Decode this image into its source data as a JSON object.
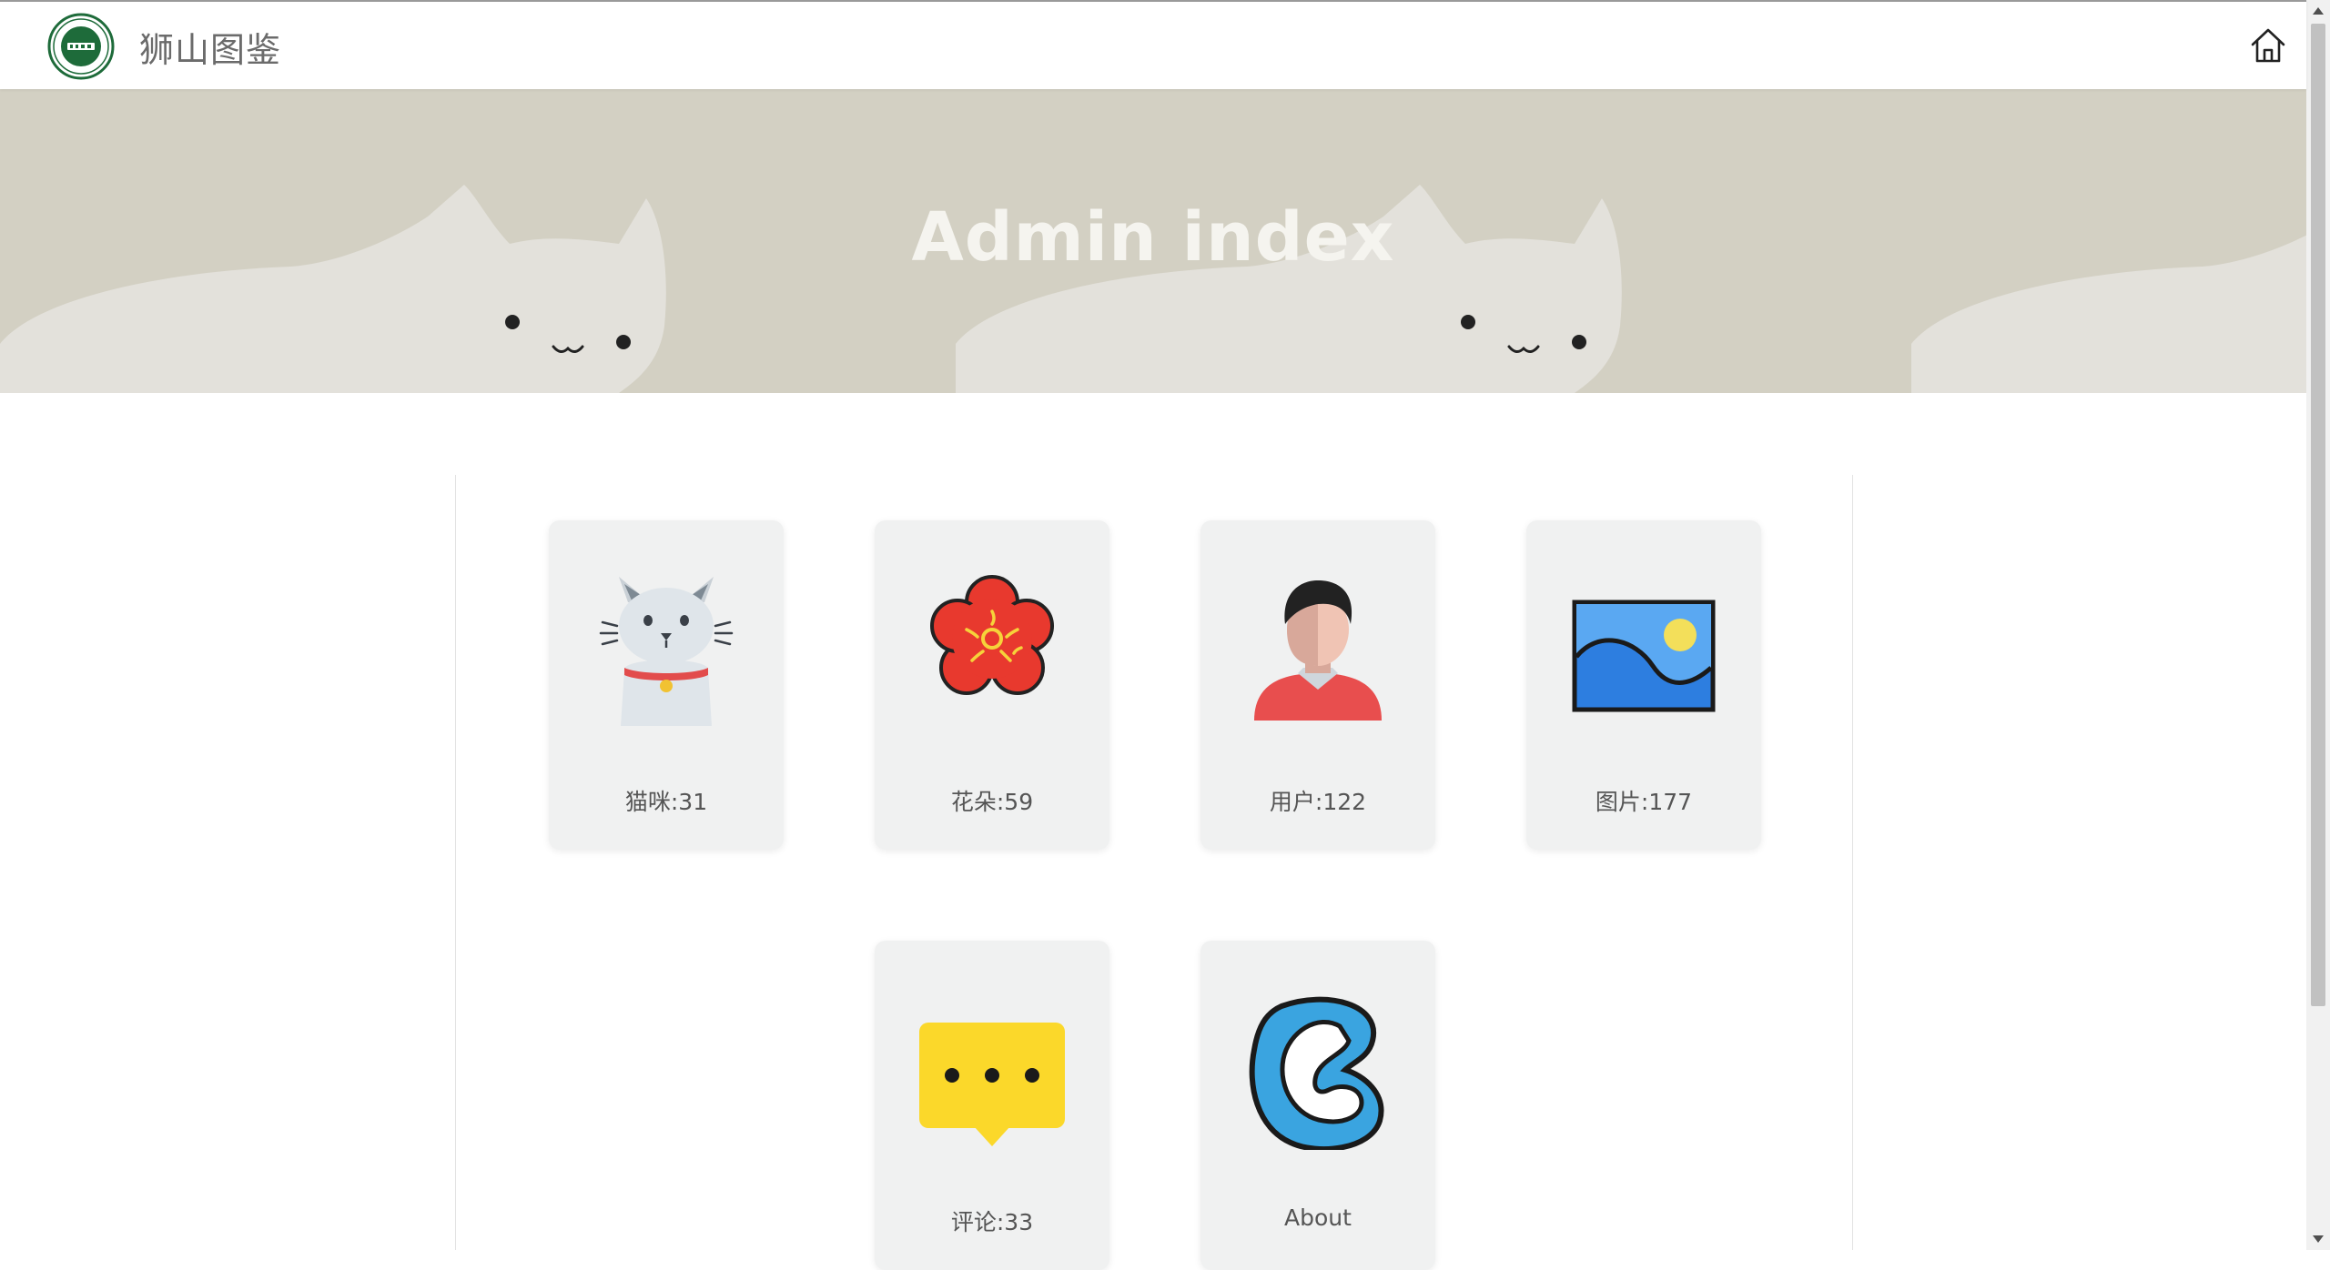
{
  "header": {
    "site_title": "狮山图鉴",
    "logo_icon": "campus-seal-logo",
    "home_icon": "home-icon"
  },
  "hero": {
    "title": "Admin index"
  },
  "cards": [
    {
      "label": "猫咪:31",
      "icon": "cat-icon"
    },
    {
      "label": "花朵:59",
      "icon": "flower-icon"
    },
    {
      "label": "用户:122",
      "icon": "user-icon"
    },
    {
      "label": "图片:177",
      "icon": "image-icon"
    },
    {
      "label": "评论:33",
      "icon": "comment-icon"
    },
    {
      "label": "About",
      "icon": "about-logo-icon"
    }
  ],
  "colors": {
    "hero_bg": "#d3d0c3",
    "card_bg": "#f0f1f1",
    "logo_green": "#1e6b3a"
  }
}
